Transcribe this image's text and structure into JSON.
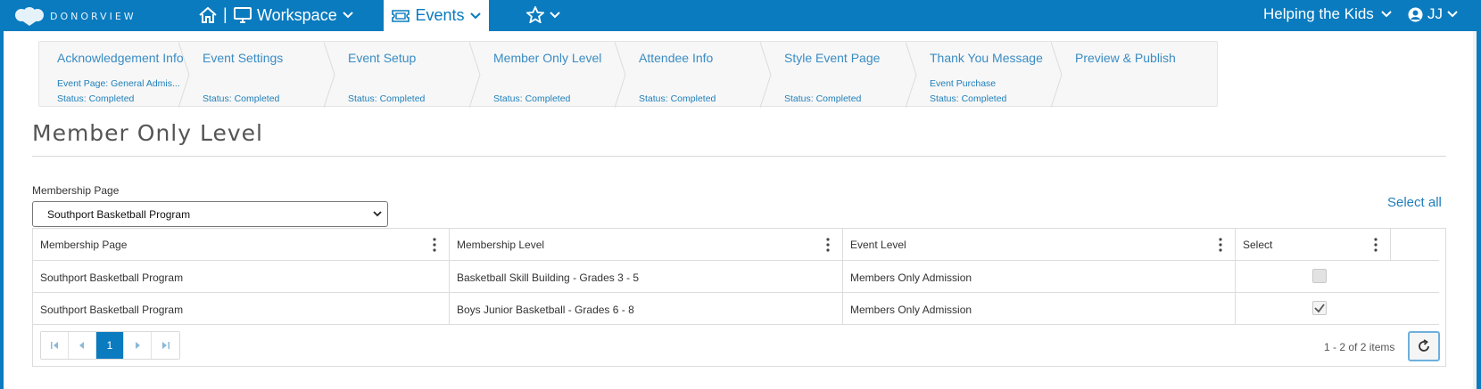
{
  "app": {
    "brand": "DONORVIEW",
    "colors": {
      "primary": "#0a7bbf",
      "link": "#1f7fba",
      "step_title": "#3a8cc4"
    }
  },
  "nav": {
    "separator": "|",
    "workspace_label": "Workspace",
    "events_label": "Events",
    "org_label": "Helping the Kids",
    "user_initials": "JJ",
    "icons": [
      "home-icon",
      "monitor-icon",
      "ticket-icon",
      "star-icon",
      "user-circle-icon",
      "chevron-down-icon"
    ]
  },
  "wizard": {
    "steps": [
      {
        "title": "Acknowledgement Info",
        "sub": "Event Page: General Admis...",
        "status": "Status: Completed"
      },
      {
        "title": "Event Settings",
        "sub": "",
        "status": "Status: Completed"
      },
      {
        "title": "Event Setup",
        "sub": "",
        "status": "Status: Completed"
      },
      {
        "title": "Member Only Level",
        "sub": "",
        "status": "Status: Completed"
      },
      {
        "title": "Attendee Info",
        "sub": "",
        "status": "Status: Completed"
      },
      {
        "title": "Style Event Page",
        "sub": "",
        "status": "Status: Completed"
      },
      {
        "title": "Thank You Message",
        "sub": "Event Purchase",
        "status": "Status: Completed"
      },
      {
        "title": "Preview & Publish",
        "sub": "",
        "status": ""
      }
    ]
  },
  "page": {
    "title": "Member Only Level",
    "field_label": "Membership Page",
    "selected_membership_page": "Southport Basketball Program",
    "select_all_label": "Select all"
  },
  "grid": {
    "columns": [
      "Membership Page",
      "Membership Level",
      "Event Level",
      "Select"
    ],
    "rows": [
      {
        "membership_page": "Southport Basketball Program",
        "membership_level": "Basketball Skill Building - Grades 3 - 5",
        "event_level": "Members Only Admission",
        "selected": false
      },
      {
        "membership_page": "Southport Basketball Program",
        "membership_level": "Boys Junior Basketball - Grades 6 - 8",
        "event_level": "Members Only Admission",
        "selected": true
      }
    ],
    "pager": {
      "current_page": "1",
      "info": "1 - 2 of 2 items"
    }
  }
}
